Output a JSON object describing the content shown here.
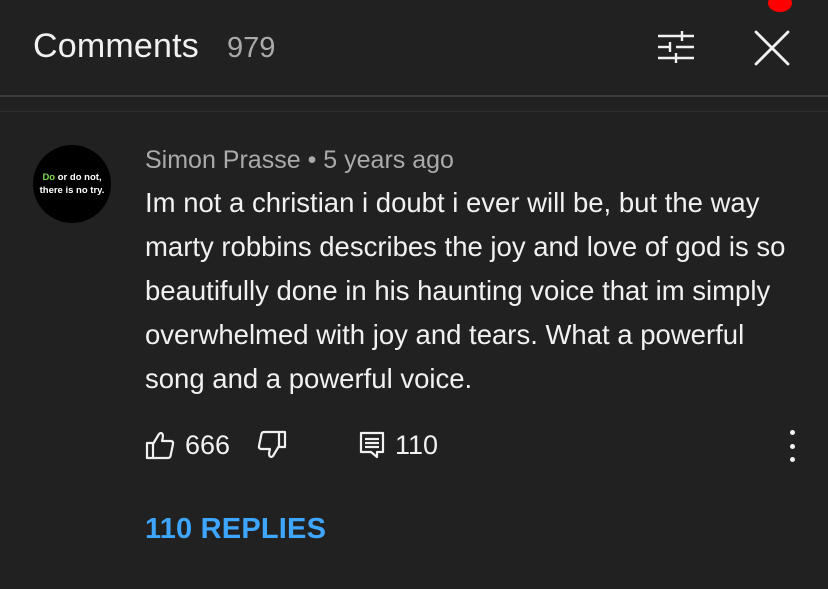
{
  "header": {
    "title": "Comments",
    "count": "979",
    "filter_icon": "sliders-icon",
    "close_icon": "close-icon"
  },
  "comment": {
    "avatar_text_green": "Do",
    "avatar_text_line1_rest": "or do not,",
    "avatar_text_line2": "there is no try.",
    "author": "Simon Prasse",
    "separator": "•",
    "time": "5 years ago",
    "text": "Im not a christian i doubt i ever will be, but the way marty robbins describes the joy and love of god is so beautifully done in his haunting voice that im simply overwhelmed with joy and tears. What a powerful song and a powerful voice.",
    "likes": "666",
    "reply_count": "110",
    "replies_label": "110 REPLIES"
  },
  "colors": {
    "background": "#212121",
    "link": "#3ea6ff",
    "notification": "#ff0000"
  }
}
